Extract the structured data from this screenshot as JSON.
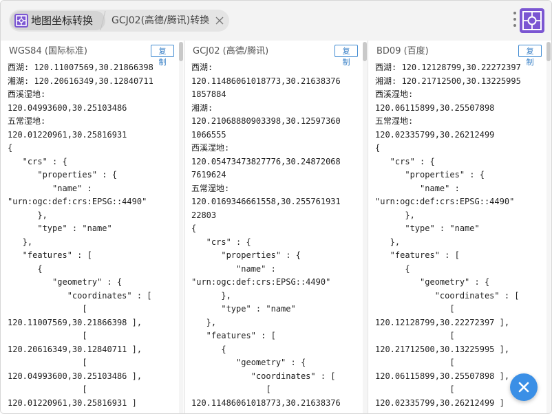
{
  "tabs": {
    "home_label": "地图坐标转换",
    "active_label": "GCJ02(高德/腾讯)转换",
    "home_icon": "map-grid-icon",
    "close_icon": "close-icon"
  },
  "toolbar": {
    "more_icon": "more-vertical-icon",
    "logo_icon": "app-logo-icon"
  },
  "colors": {
    "accent": "#7b56d2",
    "link": "#2f7ac4",
    "fab": "#3a8fe6"
  },
  "panels": [
    {
      "title": "WGS84 (国际标准)",
      "copy_label": "复制",
      "text": "西湖: 120.11007569,30.21866398\n湘湖: 120.20616349,30.12840711\n西溪湿地:\n120.04993600,30.25103486\n五常湿地:\n120.01220961,30.25816931\n{\n   \"crs\" : {\n      \"properties\" : {\n         \"name\" :\n\"urn:ogc:def:crs:EPSG::4490\"\n      },\n      \"type\" : \"name\"\n   },\n   \"features\" : [\n      {\n         \"geometry\" : {\n            \"coordinates\" : [\n               [\n120.11007569,30.21866398 ],\n               [\n120.20616349,30.12840711 ],\n               [\n120.04993600,30.25103486 ],\n               [\n120.01220961,30.25816931 ]"
    },
    {
      "title": "GCJ02 (高德/腾讯)",
      "copy_label": "复制",
      "text": "西湖:\n120.11486061018773,30.21638376\n1857884\n湘湖:\n120.21068880903398,30.12597360\n1066555\n西溪湿地:\n120.05473473827776,30.24872068\n7619624\n五常湿地:\n120.0169346661558,30.255761931\n22803\n{\n   \"crs\" : {\n      \"properties\" : {\n         \"name\" :\n\"urn:ogc:def:crs:EPSG::4490\"\n      },\n      \"type\" : \"name\"\n   },\n   \"features\" : [\n      {\n         \"geometry\" : {\n            \"coordinates\" : [\n               [\n120.11486061018773,30.21638376"
    },
    {
      "title": "BD09 (百度)",
      "copy_label": "复制",
      "text": "西湖: 120.12128799,30.22272397\n湘湖: 120.21712500,30.13225995\n西溪湿地:\n120.06115899,30.25507898\n五常湿地:\n120.02335799,30.26212499\n{\n   \"crs\" : {\n      \"properties\" : {\n         \"name\" :\n\"urn:ogc:def:crs:EPSG::4490\"\n      },\n      \"type\" : \"name\"\n   },\n   \"features\" : [\n      {\n         \"geometry\" : {\n            \"coordinates\" : [\n               [\n120.12128799,30.22272397 ],\n               [\n120.21712500,30.13225995 ],\n               [\n120.06115899,30.25507898 ],\n               [\n120.02335799,30.26212499 ]"
    }
  ],
  "fab": {
    "icon": "close-icon"
  }
}
